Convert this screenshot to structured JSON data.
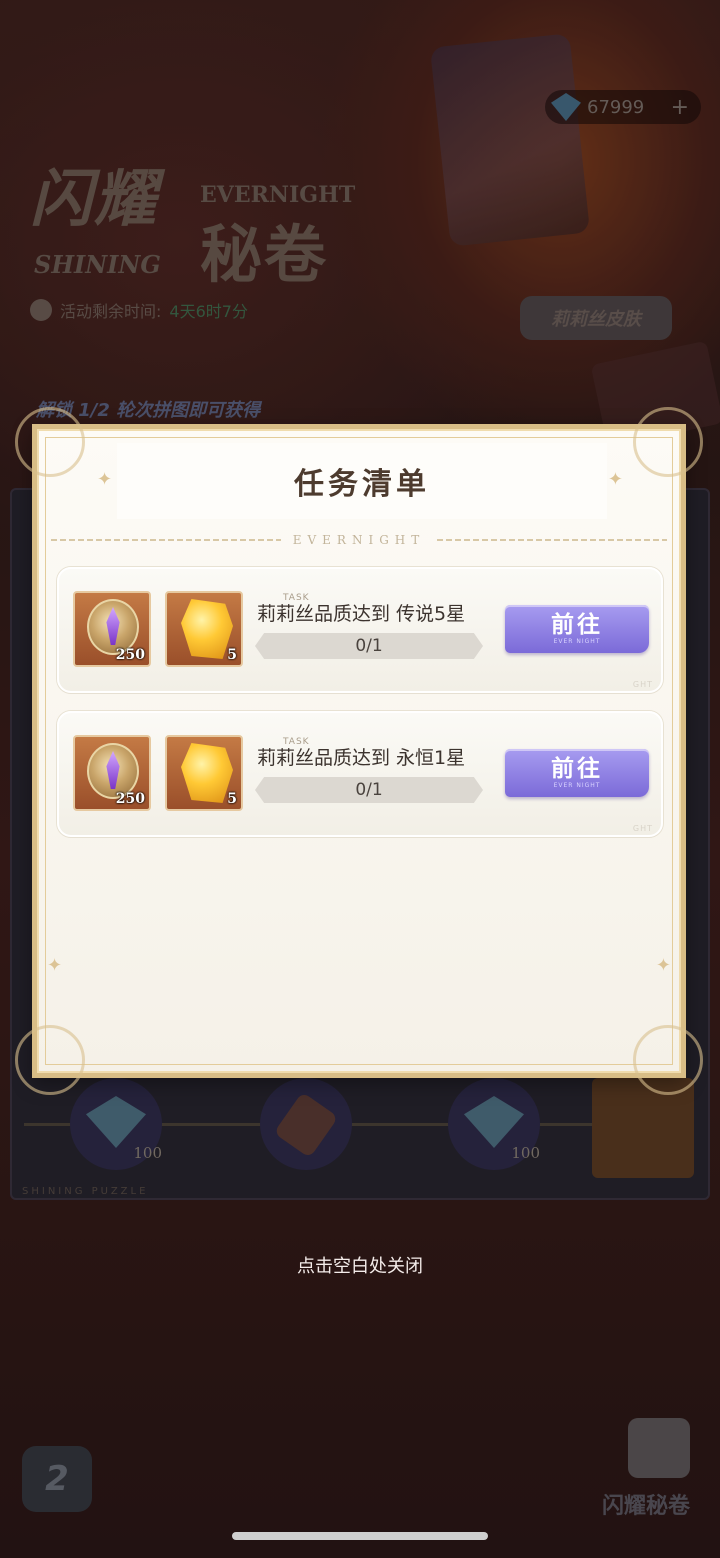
{
  "background": {
    "event_title_line1": "闪耀",
    "event_title_line2": "秘卷",
    "event_title_en1": "EVERNIGHT",
    "event_title_en2": "SHINING",
    "timer_label": "活动剩余时间:",
    "timer_value": "4天6时7分",
    "currency_amount": "67999",
    "currency_add": "+",
    "skin_tag": "莉莉丝皮肤",
    "progress_text": "解锁 1/2 轮次拼图即可获得",
    "rewards": [
      {
        "icon": "gem-icon",
        "qty": "100"
      },
      {
        "icon": "key-icon",
        "qty": ""
      },
      {
        "icon": "gem-icon",
        "qty": "100"
      }
    ],
    "footer_text": "SHINING PUZZLE",
    "corner_badge": "闪耀秘卷"
  },
  "modal": {
    "title": "任务清单",
    "deco_word": "EVERNIGHT",
    "tasks": [
      {
        "label_en": "TASK",
        "description": "莉莉丝品质达到 传说5星",
        "progress": "0/1",
        "progress_fraction": 0,
        "button": "前往",
        "button_sub": "EVER NIGHT",
        "rewards": [
          {
            "icon": "evernight-coin-icon",
            "qty": "250"
          },
          {
            "icon": "gold-crystal-icon",
            "qty": "5"
          }
        ]
      },
      {
        "label_en": "TASK",
        "description": "莉莉丝品质达到 永恒1星",
        "progress": "0/1",
        "progress_fraction": 0,
        "button": "前往",
        "button_sub": "EVER NIGHT",
        "rewards": [
          {
            "icon": "evernight-coin-icon",
            "qty": "250"
          },
          {
            "icon": "gold-crystal-icon",
            "qty": "5"
          }
        ]
      }
    ],
    "watermark": "GHT"
  },
  "close_hint": "点击空白处关闭",
  "colors": {
    "button_purple": "#8a7be0",
    "modal_border_gold": "#d8bd86",
    "title_brown": "#4d3b2e"
  }
}
